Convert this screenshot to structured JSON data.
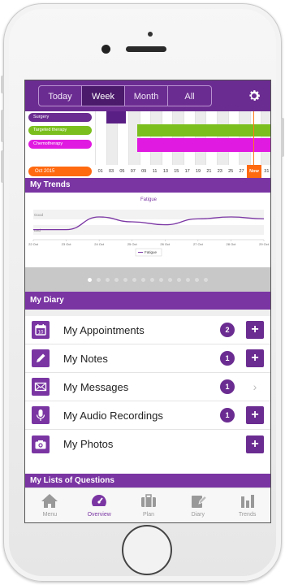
{
  "segments": {
    "items": [
      "Today",
      "Week",
      "Month",
      "All"
    ],
    "active": "Week"
  },
  "timeline": {
    "rows": [
      {
        "label": "Surgery",
        "color": "#6b2c91"
      },
      {
        "label": "Targeted therapy",
        "color": "#7bbf1e"
      },
      {
        "label": "Chemotherapy",
        "color": "#e01ae0"
      }
    ],
    "month_label": "Oct 2015",
    "dates": [
      "01",
      "03",
      "05",
      "07",
      "09",
      "11",
      "13",
      "15",
      "17",
      "19",
      "21",
      "23",
      "25",
      "27",
      "Now",
      "31"
    ]
  },
  "trends": {
    "section_title": "My Trends",
    "chart_data": {
      "type": "line",
      "title": "Fatigue",
      "x": [
        "22 Oct",
        "23 Oct",
        "24 Oct",
        "25 Oct",
        "26 Oct",
        "27 Oct",
        "28 Oct",
        "29 Oct"
      ],
      "y_categories": [
        "Good",
        "Bad"
      ],
      "series": [
        {
          "name": "Fatigue",
          "color": "#7a35a3",
          "values": [
            0.1,
            0.1,
            0.75,
            0.5,
            0.35,
            0.65,
            0.75,
            0.65
          ]
        }
      ],
      "legend": "bottom-center"
    },
    "pager_count": 14,
    "pager_active": 0
  },
  "diary": {
    "title": "My Diary",
    "items": [
      {
        "label": "My Appointments",
        "icon": "calendar-icon",
        "badge": "2",
        "action": "plus"
      },
      {
        "label": "My Notes",
        "icon": "pencil-icon",
        "badge": "1",
        "action": "plus"
      },
      {
        "label": "My Messages",
        "icon": "envelope-icon",
        "badge": "1",
        "action": "chevron"
      },
      {
        "label": "My Audio Recordings",
        "icon": "microphone-icon",
        "badge": "1",
        "action": "plus"
      },
      {
        "label": "My Photos",
        "icon": "camera-icon",
        "badge": "",
        "action": "plus"
      }
    ],
    "plus_label": "+",
    "chevron_label": "›"
  },
  "lists": {
    "title": "My Lists of Questions"
  },
  "tabbar": {
    "items": [
      {
        "label": "Menu",
        "icon": "home-icon"
      },
      {
        "label": "Overview",
        "icon": "speedometer-icon"
      },
      {
        "label": "Plan",
        "icon": "briefcase-icon"
      },
      {
        "label": "Diary",
        "icon": "diary-pen-icon"
      },
      {
        "label": "Trends",
        "icon": "bar-chart-icon"
      }
    ],
    "active": "Overview"
  },
  "colors": {
    "brand": "#7a35a3",
    "brand_dark": "#6b2c91",
    "now": "#ff6a10"
  }
}
